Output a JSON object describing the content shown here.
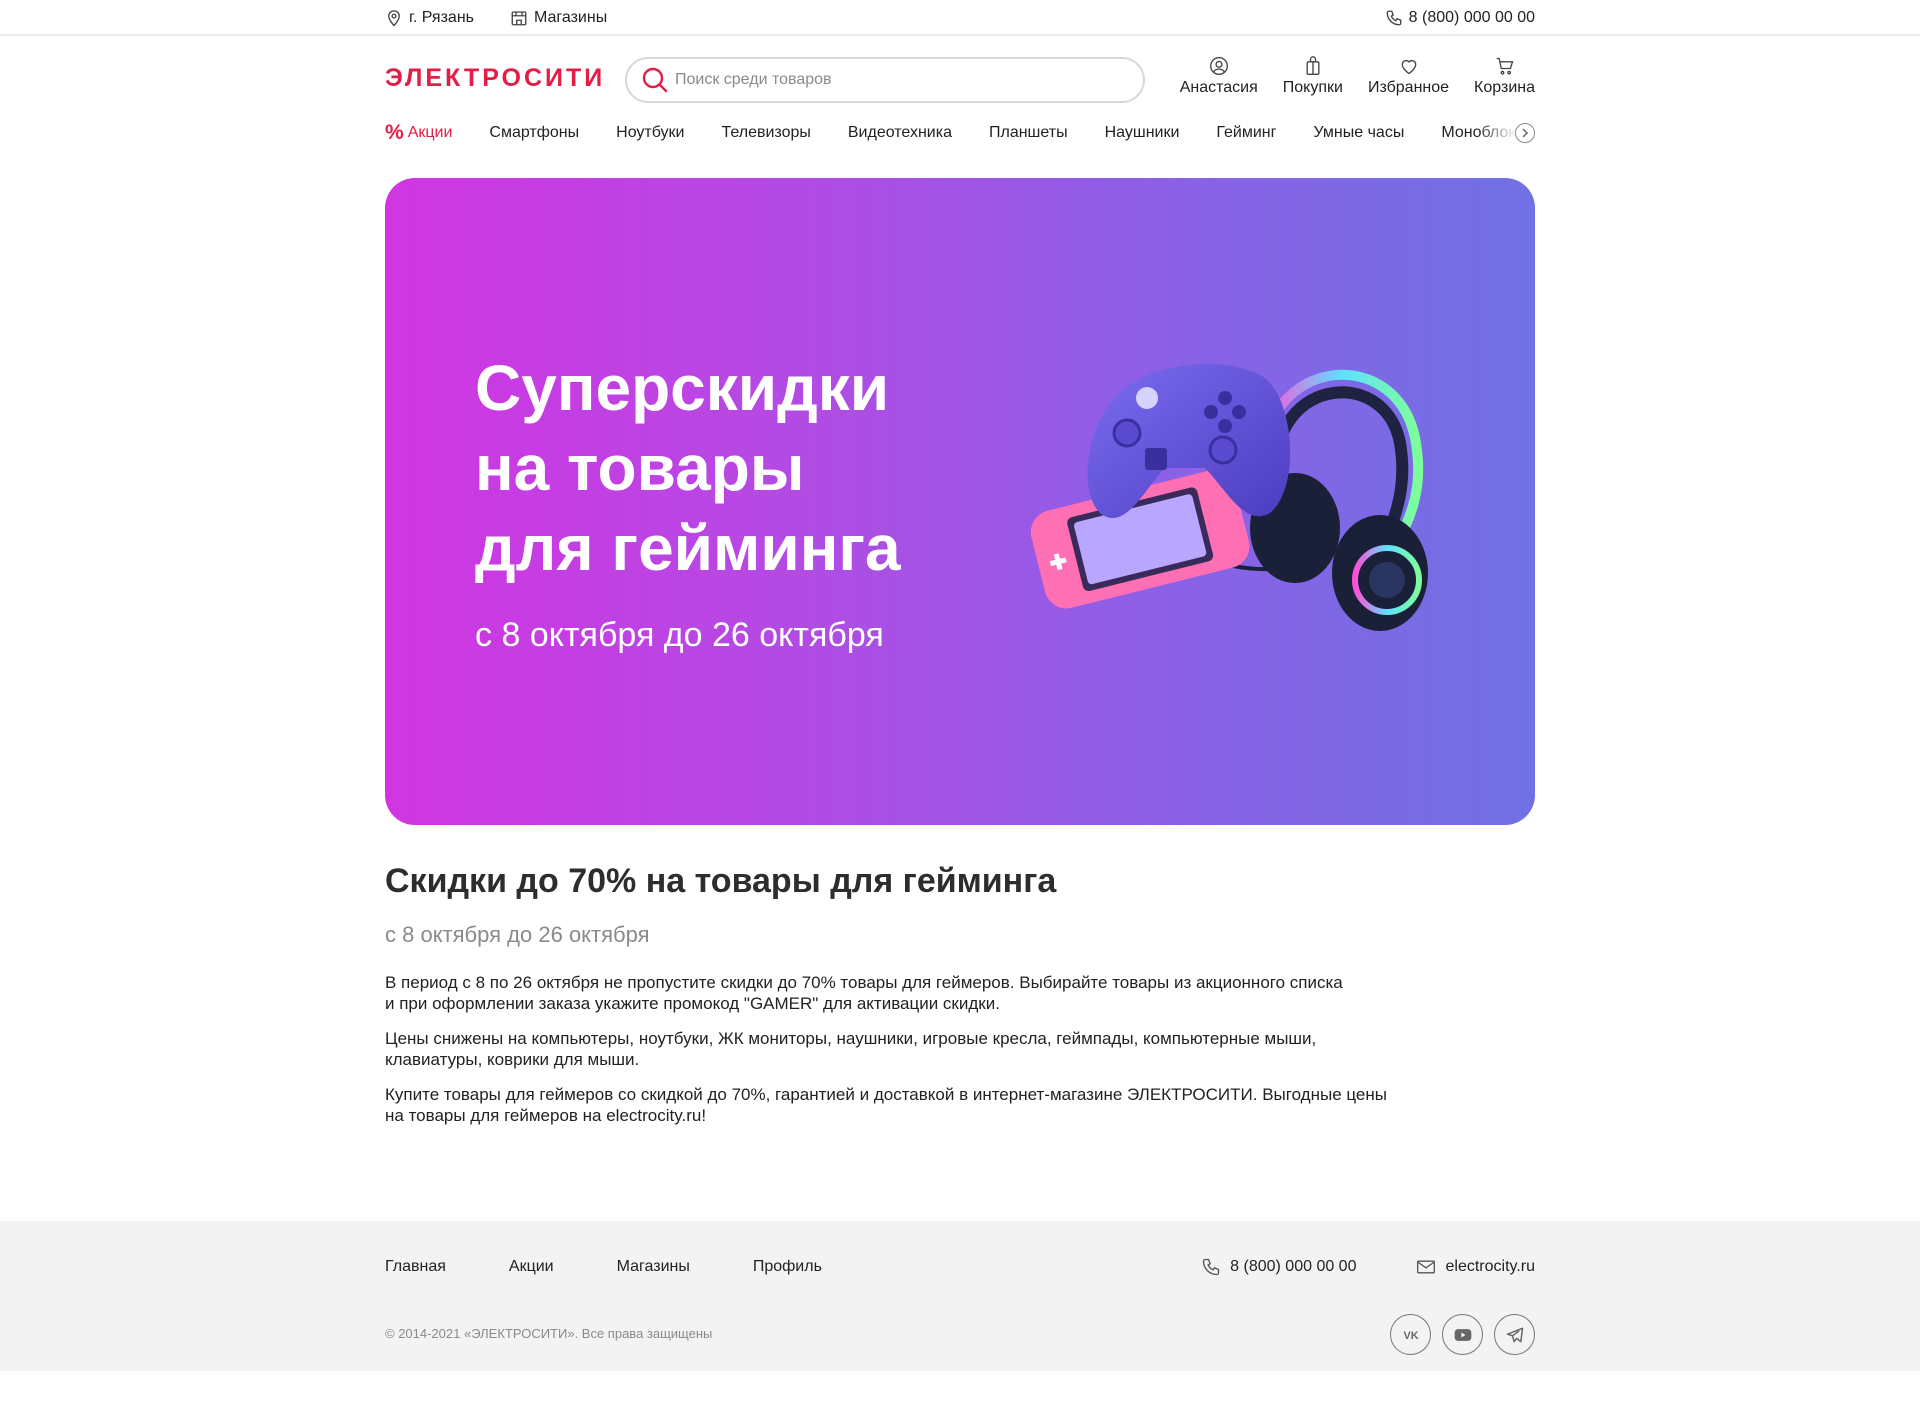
{
  "topbar": {
    "city": "г. Рязань",
    "stores": "Магазины",
    "phone": "8 (800) 000 00 00"
  },
  "header": {
    "logo": "ЭЛЕКТРОСИТИ",
    "search_placeholder": "Поиск среди товаров",
    "actions": {
      "profile": "Анастасия",
      "purchases": "Покупки",
      "favorites": "Избранное",
      "cart": "Корзина"
    }
  },
  "nav": {
    "promo": "Акции",
    "items": [
      "Смартфоны",
      "Ноутбуки",
      "Телевизоры",
      "Видеотехника",
      "Планшеты",
      "Наушники",
      "Гейминг",
      "Умные часы",
      "Моноблоки"
    ]
  },
  "banner": {
    "title": "Суперскидки\nна товары\nдля гейминга",
    "dates": "с 8 октября до 26 октября"
  },
  "article": {
    "title": "Скидки до 70% на товары для гейминга",
    "dates": "с 8 октября до 26 октября",
    "paragraphs": [
      "В период с 8 по 26 октября не пропустите скидки до 70% товары для геймеров. Выбирайте товары из акционного списка\nи при оформлении заказа укажите промокод \"GAMER\" для активации скидки.",
      "Цены снижены на компьютеры, ноутбуки, ЖК мониторы, наушники, игровые кресла, геймпады, компьютерные мыши,\nклавиатуры, коврики для мыши.",
      "Купите товары для геймеров со скидкой до 70%, гарантией и доставкой в интернет-магазине ЭЛЕКТРОСИТИ. Выгодные цены\nна товары для геймеров на electrocity.ru!"
    ]
  },
  "footer": {
    "nav": [
      "Главная",
      "Акции",
      "Магазины",
      "Профиль"
    ],
    "phone": "8 (800) 000 00 00",
    "email": "electrocity.ru",
    "copyright": "© 2014-2021 «ЭЛЕКТРОСИТИ». Все права защищены",
    "social": [
      "vk-icon",
      "youtube-icon",
      "telegram-icon"
    ]
  },
  "colors": {
    "brand": "#e31d45",
    "banner_start": "#d135e2",
    "banner_end": "#7071e4",
    "footer_bg": "#f3f3f3"
  }
}
